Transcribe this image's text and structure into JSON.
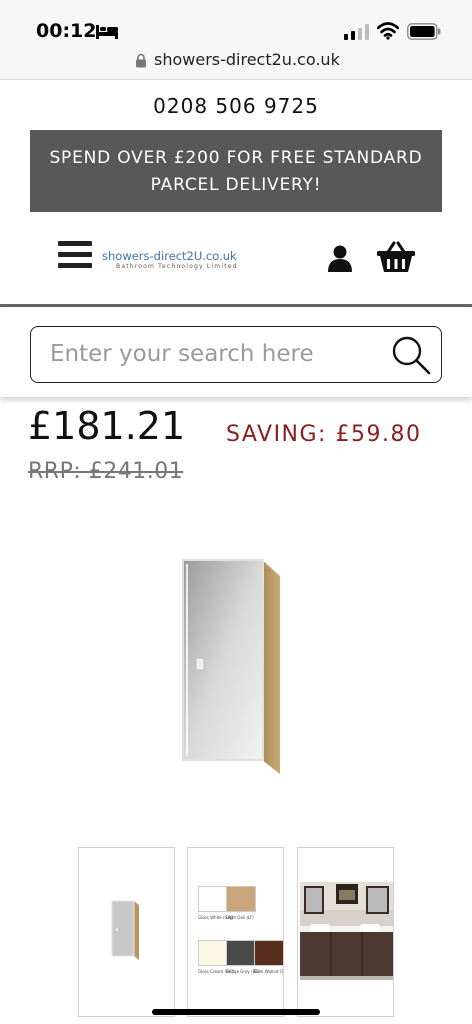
{
  "status_bar": {
    "time": "00:12"
  },
  "browser": {
    "url": "showers-direct2u.co.uk"
  },
  "header": {
    "phone": "0208 506 9725",
    "promo_line1": "SPEND OVER £200 FOR FREE STANDARD",
    "promo_line2": "PARCEL DELIVERY!",
    "logo_main": "showers-direct2U.co.uk",
    "logo_sub": "Bathroom Technology Limited"
  },
  "search": {
    "placeholder": "Enter your search here"
  },
  "product": {
    "price": "£181.21",
    "saving": "SAVING: £59.80",
    "rrp": "RRP: £241.01"
  },
  "thumbnails": {
    "swatches": [
      {
        "label": "Gloss White (GW)",
        "color": "#ffffff"
      },
      {
        "label": "Light Oak (LT)",
        "color": "#c8a57a"
      },
      {
        "label": "Gloss Cream (GC)",
        "color": "#fbf7e4"
      },
      {
        "label": "Bridge Grey (BG)",
        "color": "#4a4a4a"
      },
      {
        "label": "Dark Walnut (DW)",
        "color": "#5a2e1c"
      }
    ]
  },
  "colors": {
    "promo_bg": "#585858",
    "saving_red": "#8b1d1d",
    "logo_blue": "#3f73b3"
  }
}
